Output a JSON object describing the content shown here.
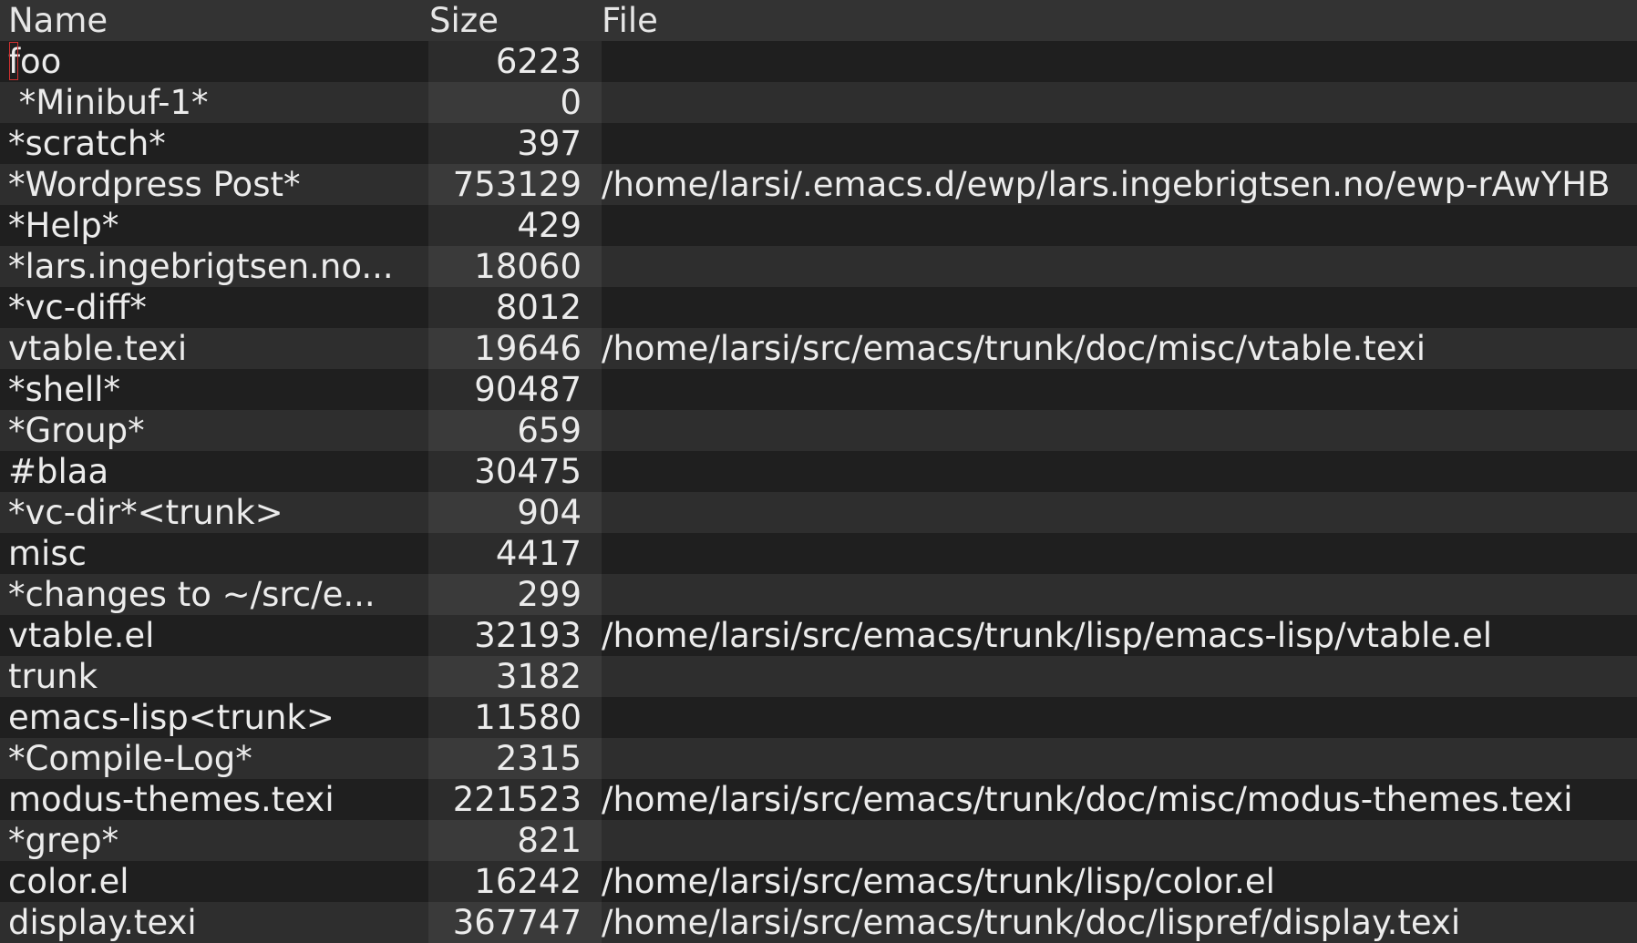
{
  "columns": {
    "name": "Name",
    "size": "Size",
    "file": "File"
  },
  "rows": [
    {
      "name": "foo",
      "size": "6223",
      "file": ""
    },
    {
      "name": " *Minibuf-1*",
      "size": "0",
      "file": ""
    },
    {
      "name": "*scratch*",
      "size": "397",
      "file": ""
    },
    {
      "name": "*Wordpress Post*",
      "size": "753129",
      "file": "/home/larsi/.emacs.d/ewp/lars.ingebrigtsen.no/ewp-rAwYHB"
    },
    {
      "name": "*Help*",
      "size": "429",
      "file": ""
    },
    {
      "name": "*lars.ingebrigtsen.no...",
      "size": "18060",
      "file": ""
    },
    {
      "name": "*vc-diff*",
      "size": "8012",
      "file": ""
    },
    {
      "name": "vtable.texi",
      "size": "19646",
      "file": "/home/larsi/src/emacs/trunk/doc/misc/vtable.texi"
    },
    {
      "name": "*shell*",
      "size": "90487",
      "file": ""
    },
    {
      "name": "*Group*",
      "size": "659",
      "file": ""
    },
    {
      "name": "#blaa",
      "size": "30475",
      "file": ""
    },
    {
      "name": "*vc-dir*<trunk>",
      "size": "904",
      "file": ""
    },
    {
      "name": "misc",
      "size": "4417",
      "file": ""
    },
    {
      "name": "*changes to ~/src/e...",
      "size": "299",
      "file": ""
    },
    {
      "name": "vtable.el",
      "size": "32193",
      "file": "/home/larsi/src/emacs/trunk/lisp/emacs-lisp/vtable.el"
    },
    {
      "name": "trunk",
      "size": "3182",
      "file": ""
    },
    {
      "name": "emacs-lisp<trunk>",
      "size": "11580",
      "file": ""
    },
    {
      "name": "*Compile-Log*",
      "size": "2315",
      "file": ""
    },
    {
      "name": "modus-themes.texi",
      "size": "221523",
      "file": "/home/larsi/src/emacs/trunk/doc/misc/modus-themes.texi"
    },
    {
      "name": "*grep*",
      "size": "821",
      "file": ""
    },
    {
      "name": "color.el",
      "size": "16242",
      "file": "/home/larsi/src/emacs/trunk/lisp/color.el"
    },
    {
      "name": "display.texi",
      "size": "367747",
      "file": "/home/larsi/src/emacs/trunk/doc/lispref/display.texi"
    }
  ],
  "colors": {
    "background": "#1e1e1e",
    "header_bg": "#333333",
    "row_dark": "#1f1f1f",
    "row_light": "#2e2e2e",
    "cursor": "#d03030",
    "text": "#ececec"
  }
}
